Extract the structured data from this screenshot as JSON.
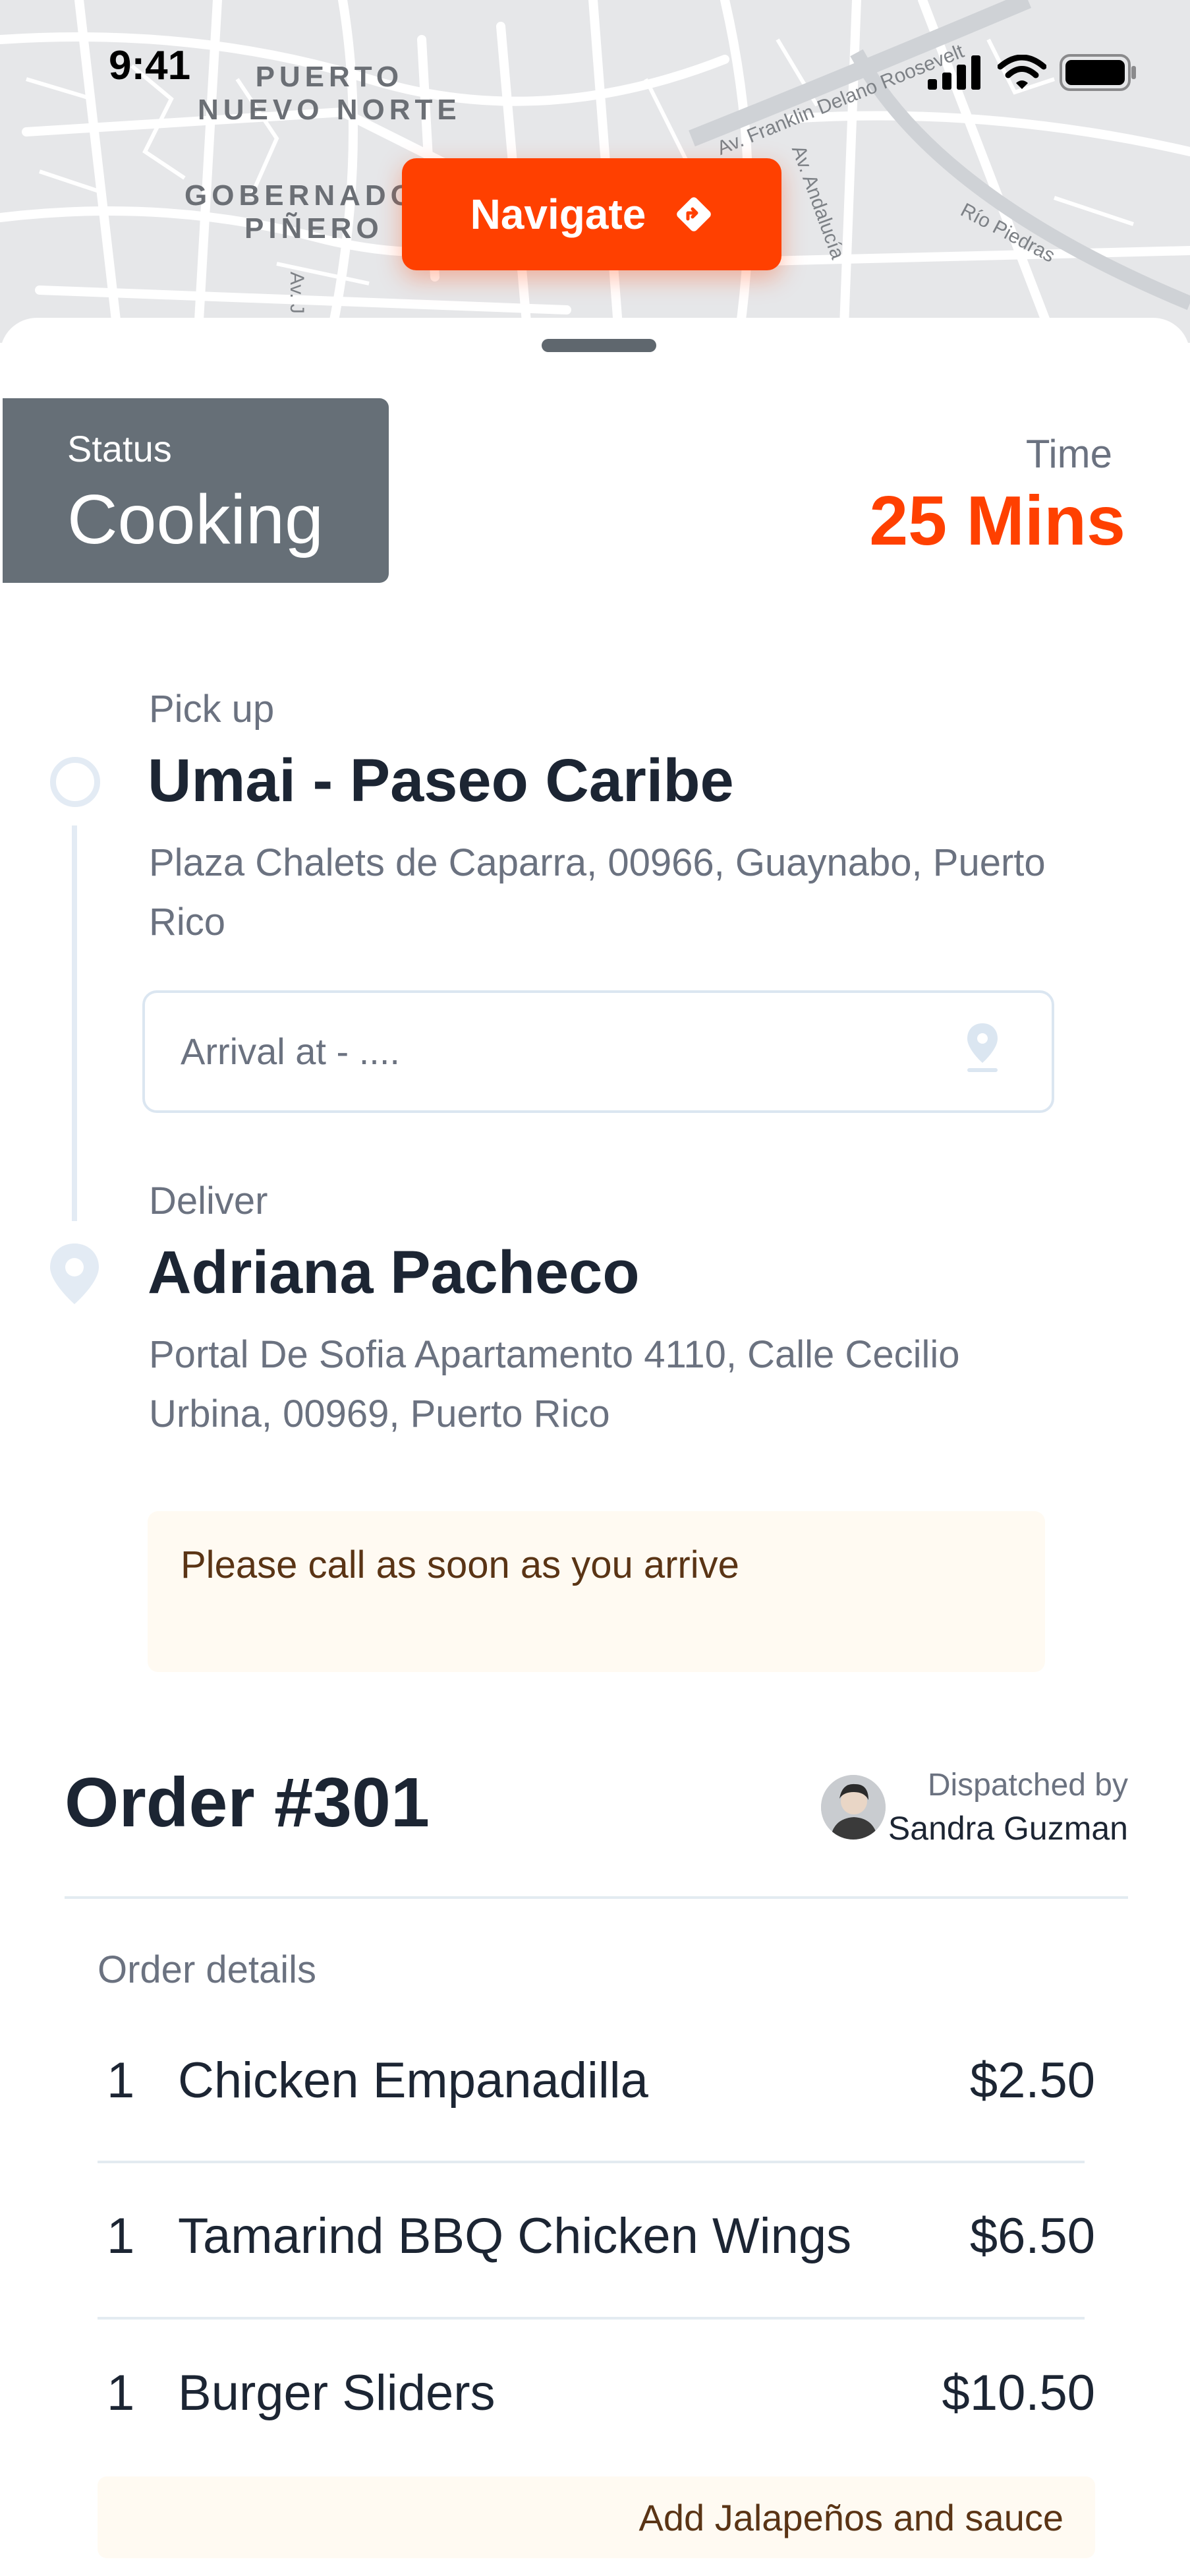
{
  "status_bar": {
    "time": "9:41"
  },
  "map": {
    "labels": [
      "PUERTO",
      "NUEVO NORTE",
      "GOBERNADOR",
      "PIÑERO"
    ],
    "streets": [
      "Av. Franklin Delano Roosevelt",
      "Av. Andalucía",
      "Río Piedras",
      "Av. J"
    ]
  },
  "navigate_button": {
    "label": "Navigate"
  },
  "status": {
    "label": "Status",
    "value": "Cooking"
  },
  "time": {
    "label": "Time",
    "value": "25 Mins"
  },
  "pickup": {
    "label": "Pick up",
    "name": "Umai - Paseo Caribe",
    "address": "Plaza Chalets de Caparra, 00966, Guaynabo, Puerto Rico"
  },
  "arrival_input": {
    "placeholder": "Arrival at - ...."
  },
  "deliver": {
    "label": "Deliver",
    "name": "Adriana Pacheco",
    "address": "Portal De Sofia Apartamento 4110, Calle Cecilio Urbina, 00969, Puerto Rico"
  },
  "note": "Please call as soon as you arrive",
  "order": {
    "title": "Order #301",
    "dispatched_label": "Dispatched by",
    "dispatched_by": "Sandra Guzman",
    "details_label": "Order details",
    "items": [
      {
        "qty": "1",
        "name": "Chicken Empanadilla",
        "price": "$2.50"
      },
      {
        "qty": "1",
        "name": "Tamarind BBQ Chicken Wings",
        "price": "$6.50"
      },
      {
        "qty": "1",
        "name": "Burger Sliders",
        "price": "$10.50",
        "note": "Add Jalapeños and sauce"
      }
    ]
  },
  "colors": {
    "accent": "#ff4000",
    "status_bg": "#666f77",
    "note_bg": "#fffaf2",
    "text": "#1c2533",
    "muted": "#6b7280"
  }
}
